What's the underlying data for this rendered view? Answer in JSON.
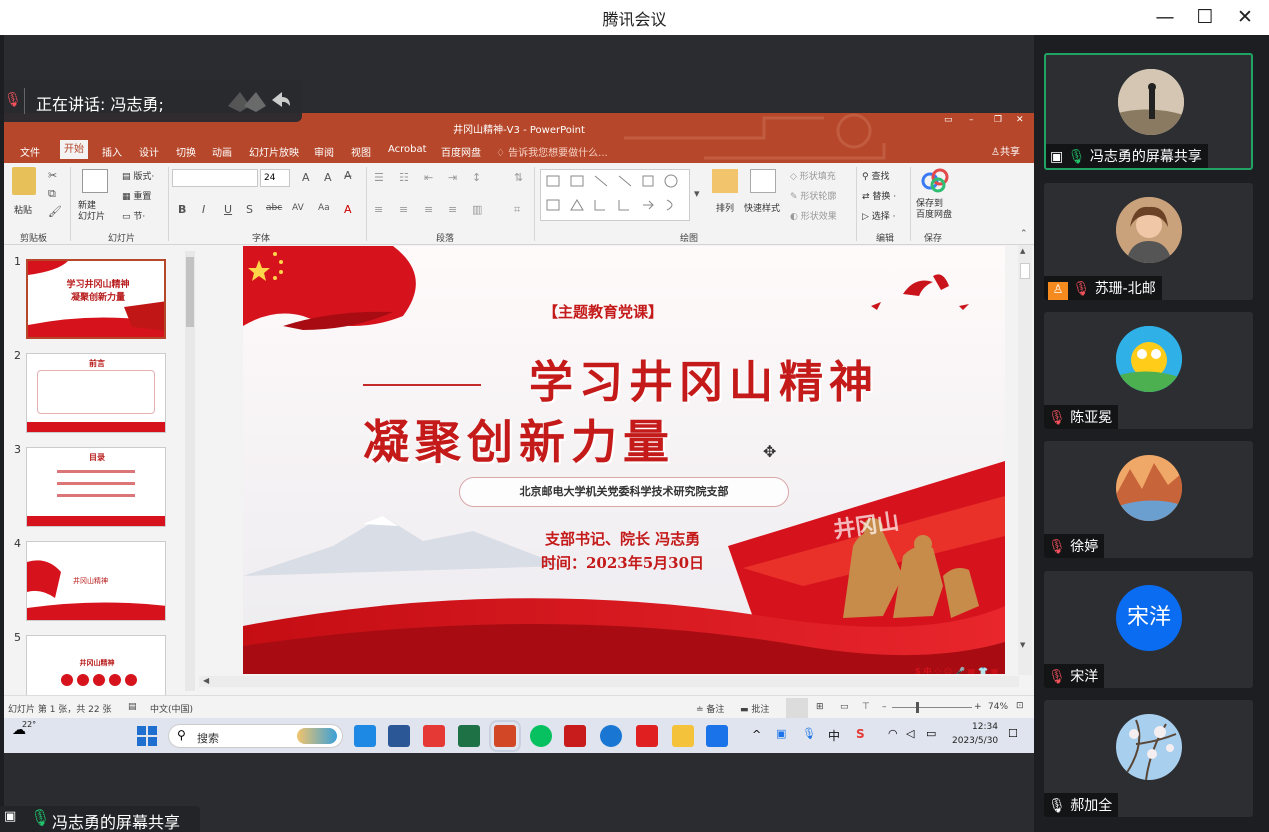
{
  "window": {
    "title": "腾讯会议"
  },
  "speaking": {
    "label": "正在讲话: 冯志勇;"
  },
  "ppt": {
    "title": "井冈山精神-V3 - PowerPoint",
    "tabs": [
      "文件",
      "开始",
      "插入",
      "设计",
      "切换",
      "动画",
      "幻灯片放映",
      "审阅",
      "视图",
      "Acrobat",
      "百度网盘"
    ],
    "active_tab": "开始",
    "tellme": "告诉我您想要做什么...",
    "share": "共享",
    "ribbon": {
      "paste": "粘贴",
      "new_slide": "新建\n幻灯片",
      "layout": "版式",
      "reset": "重置",
      "section": "节",
      "font_size": "24",
      "arrange": "排列",
      "quick_styles": "快速样式",
      "shape_fill": "形状填充",
      "shape_outline": "形状轮廓",
      "shape_effects": "形状效果",
      "find": "查找",
      "replace": "替换",
      "select": "选择",
      "save_baidu": "保存到\n百度网盘",
      "groups": [
        "剪贴板",
        "幻灯片",
        "字体",
        "段落",
        "绘图",
        "编辑",
        "保存"
      ]
    },
    "thumbnails": [
      {
        "num": "1",
        "title": "学习井冈山精神",
        "sub": "凝聚创新力量"
      },
      {
        "num": "2",
        "title": "前言"
      },
      {
        "num": "3",
        "title": "目录"
      },
      {
        "num": "4",
        "title": "井冈山精神"
      },
      {
        "num": "5",
        "title": "井冈山精神"
      }
    ],
    "slide": {
      "tag": "【主题教育党课】",
      "title1": "学习井冈山精神",
      "title2": "凝聚创新力量",
      "org": "北京邮电大学机关党委科学技术研究院支部",
      "speaker": "支部书记、院长 冯志勇",
      "date": "时间：2023年5月30日",
      "mountain_text": "井冈山"
    },
    "status": {
      "slide_info": "幻灯片 第 1 张，共 22 张",
      "lang": "中文(中国)",
      "notes": "备注",
      "comments": "批注",
      "zoom": "74%"
    }
  },
  "taskbar": {
    "weather": "22°",
    "search": "搜索",
    "ime": "中",
    "time": "12:34",
    "date": "2023/5/30"
  },
  "share_footer": "冯志勇的屏幕共享",
  "participants": [
    {
      "name": "冯志勇的屏幕共享",
      "mic": "on",
      "active": true
    },
    {
      "name": "苏珊-北邮",
      "mic": "off"
    },
    {
      "name": "陈亚冕",
      "mic": "off"
    },
    {
      "name": "徐婷",
      "mic": "off"
    },
    {
      "name": "宋洋",
      "mic": "off",
      "initials": "宋洋"
    },
    {
      "name": "郝加全",
      "mic": "on"
    }
  ],
  "colors": {
    "ppt_red": "#b7472a",
    "accent_green": "#21a366",
    "slide_red": "#d6131c"
  }
}
